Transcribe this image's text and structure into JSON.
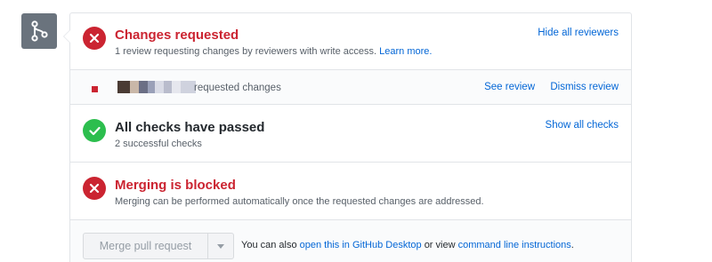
{
  "changes_requested": {
    "title": "Changes requested",
    "description": "1 review requesting changes by reviewers with write access.",
    "learn_more": "Learn more.",
    "hide_reviewers": "Hide all reviewers"
  },
  "review": {
    "text": "requested changes",
    "see_review": "See review",
    "dismiss_review": "Dismiss review"
  },
  "checks": {
    "title": "All checks have passed",
    "description": "2 successful checks",
    "show_all": "Show all checks"
  },
  "blocked": {
    "title": "Merging is blocked",
    "description": "Merging can be performed automatically once the requested changes are addressed."
  },
  "merge": {
    "button": "Merge pull request",
    "note_prefix": "You can also",
    "desktop_link": "open this in GitHub Desktop",
    "note_middle": "or view",
    "cli_link": "command line instructions",
    "note_suffix": "."
  },
  "colors": {
    "error_red": "#cb2431",
    "success_green": "#2cbe4e",
    "link_blue": "#0366d6",
    "badge_gray": "#6a737d"
  },
  "icons": {
    "badge": "git-merge-icon",
    "error": "x-circle-icon",
    "success": "check-circle-icon",
    "dropdown": "caret-down-icon"
  }
}
